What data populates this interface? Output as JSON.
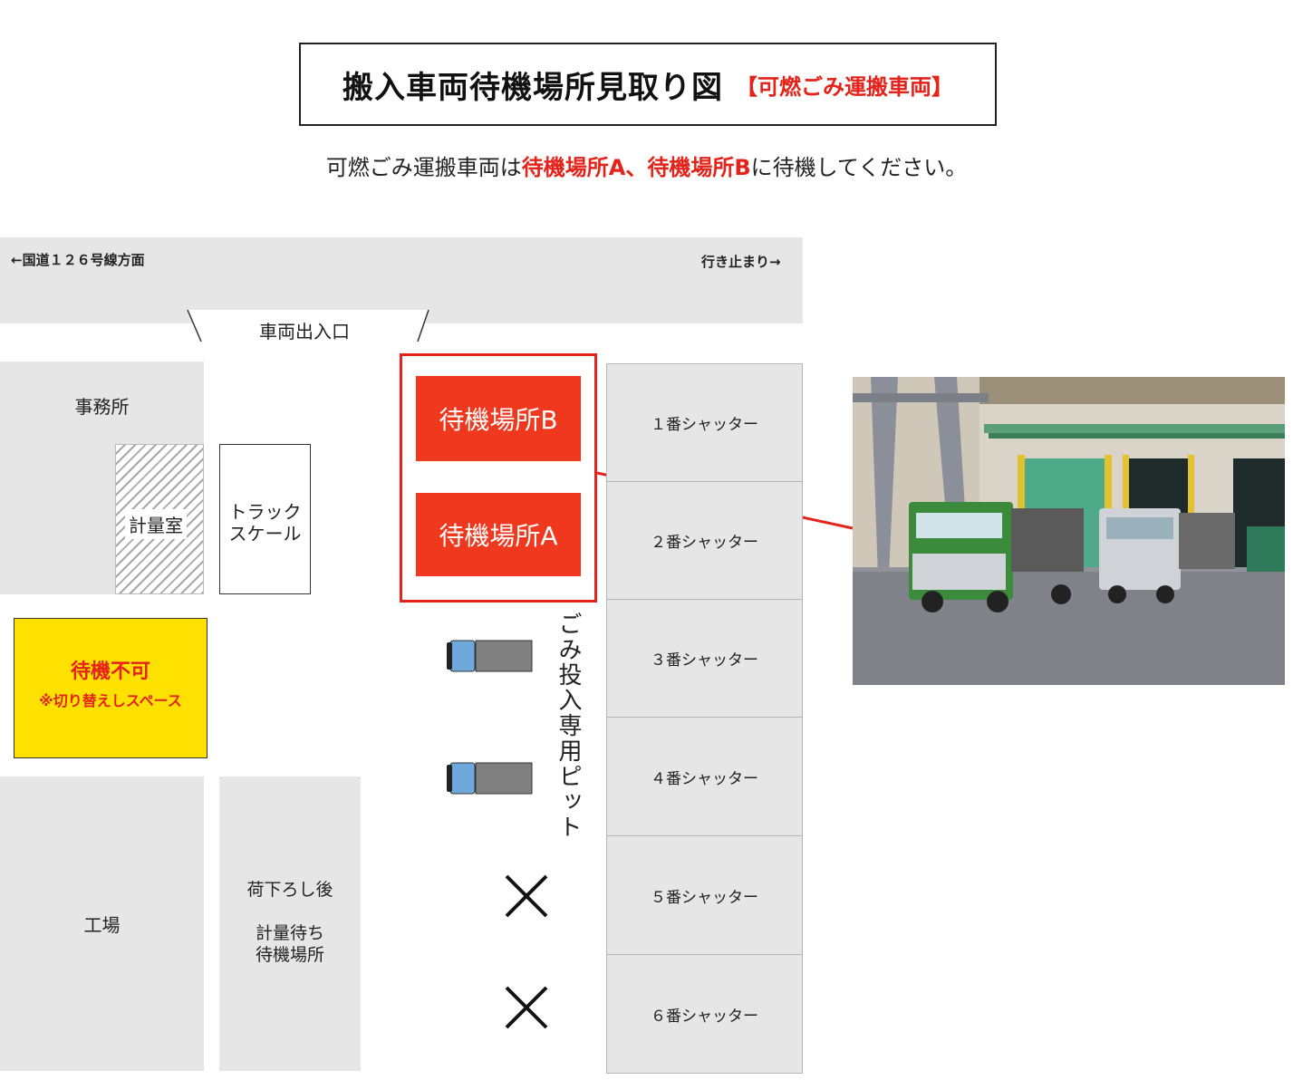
{
  "title": {
    "main": "搬入車両待機場所見取り図",
    "sub": "【可燃ごみ運搬車両】"
  },
  "subtitle": {
    "part1": "可燃ごみ運搬車両は",
    "area_a": "待機場所A",
    "sep": "、",
    "area_b": "待機場所B",
    "part2": "に待機してください。"
  },
  "road": {
    "left_label": "←国道１２６号線方面",
    "right_label": "行き止まり→",
    "gate_label": "車両出入口"
  },
  "buildings": {
    "office": "事務所",
    "weigh_room": "計量室",
    "truck_scale_line1": "トラック",
    "truck_scale_line2": "スケール",
    "no_wait_title": "待機不可",
    "no_wait_note": "※切り替えしスペース",
    "factory": "工場",
    "unload_line1": "荷下ろし後",
    "unload_line2": "計量待ち",
    "unload_line3": "待機場所"
  },
  "waiting_areas": {
    "b": "待機場所B",
    "a": "待機場所A"
  },
  "pit_label": "ごみ投入専用ピット",
  "shutters": [
    "１番シャッター",
    "２番シャッター",
    "３番シャッター",
    "４番シャッター",
    "５番シャッター",
    "６番シャッター"
  ],
  "colors": {
    "accent_red": "#e4231b",
    "wait_area_fill": "#f0381e",
    "no_wait_yellow": "#ffe100",
    "block_gray": "#e6e6e6"
  }
}
